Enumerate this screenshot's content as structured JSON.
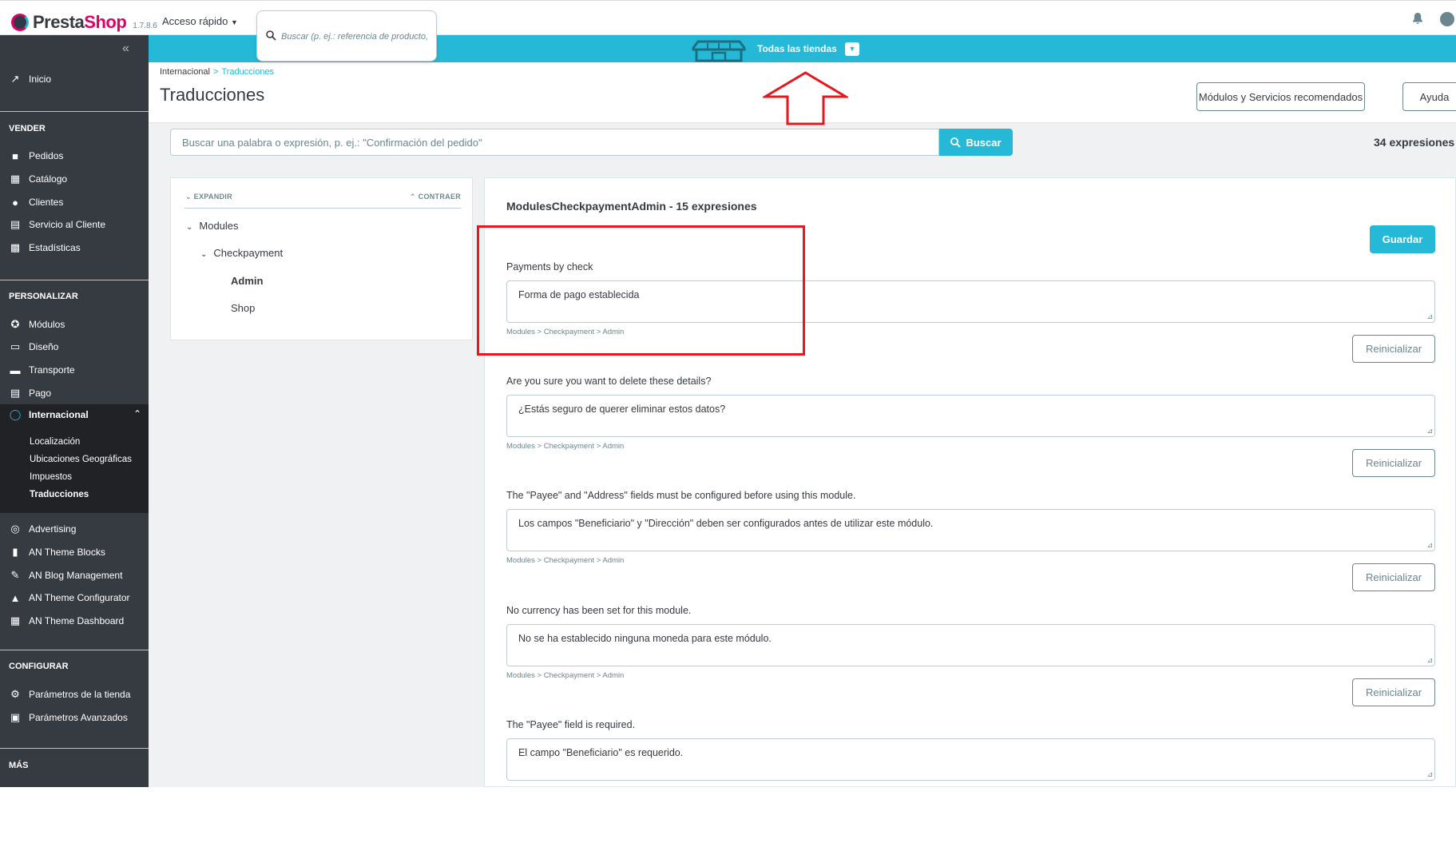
{
  "header": {
    "logo_main": "Presta",
    "logo_accent": "Shop",
    "version": "1.7.8.6",
    "quick_access": "Acceso rápido",
    "search_placeholder": "Buscar (p. ej.: referencia de producto,"
  },
  "shop_bar": {
    "label": "Todas las tiendas"
  },
  "sidebar": {
    "home": "Inicio",
    "sections": {
      "sell": "VENDER",
      "customize": "PERSONALIZAR",
      "configure": "CONFIGURAR",
      "more": "MÁS"
    },
    "sell_items": [
      "Pedidos",
      "Catálogo",
      "Clientes",
      "Servicio al Cliente",
      "Estadísticas"
    ],
    "customize_items": [
      "Módulos",
      "Diseño",
      "Transporte",
      "Pago",
      "Internacional"
    ],
    "intl_subitems": [
      "Localización",
      "Ubicaciones Geográficas",
      "Impuestos",
      "Traducciones"
    ],
    "extra_items": [
      "Advertising",
      "AN Theme Blocks",
      "AN Blog Management",
      "AN Theme Configurator",
      "AN Theme Dashboard"
    ],
    "configure_items": [
      "Parámetros de la tienda",
      "Parámetros Avanzados"
    ]
  },
  "page": {
    "breadcrumb_parent": "Internacional",
    "breadcrumb_current": "Traducciones",
    "title": "Traducciones",
    "btn_modules": "Módulos y Servicios recomendados",
    "btn_help": "Ayuda"
  },
  "search": {
    "placeholder": "Buscar una palabra o expresión, p. ej.: \"Confirmación del pedido\"",
    "button": "Buscar",
    "count": "34 expresiones"
  },
  "tree": {
    "expand": "EXPANDIR",
    "collapse": "CONTRAER",
    "nodes": [
      "Modules",
      "Checkpayment",
      "Admin",
      "Shop"
    ]
  },
  "panel": {
    "title": "ModulesCheckpaymentAdmin - 15 expresiones",
    "save": "Guardar",
    "reset": "Reinicializar",
    "path": "Modules > Checkpayment > Admin",
    "entries": [
      {
        "source": "Payments by check",
        "translation": "Forma de pago establecida"
      },
      {
        "source": "Are you sure you want to delete these details?",
        "translation": "¿Estás seguro de querer eliminar estos datos?"
      },
      {
        "source": "The \"Payee\" and \"Address\" fields must be configured before using this module.",
        "translation": "Los campos \"Beneficiario\" y \"Dirección\" deben ser configurados antes de utilizar este módulo."
      },
      {
        "source": "No currency has been set for this module.",
        "translation": "No se ha establecido ninguna moneda para este módulo."
      },
      {
        "source": "The \"Payee\" field is required.",
        "translation": "El campo \"Beneficiario\" es requerido."
      }
    ]
  },
  "colors": {
    "brand_blue": "#25b9d7",
    "sidebar_bg": "#363a41",
    "annotation_red": "#e3191f"
  }
}
